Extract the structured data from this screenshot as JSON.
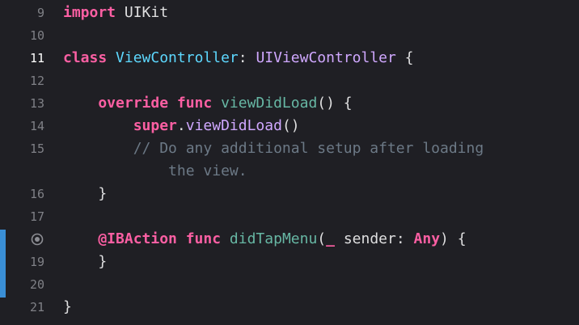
{
  "editor": {
    "lines": [
      {
        "number": "9",
        "tokens": [
          {
            "t": "import",
            "k": "kw"
          },
          {
            "t": " UIKit",
            "k": "plain"
          }
        ]
      },
      {
        "number": "10",
        "tokens": []
      },
      {
        "number": "11",
        "tokens": [
          {
            "t": "class",
            "k": "kw"
          },
          {
            "t": " ",
            "k": "plain"
          },
          {
            "t": "ViewController",
            "k": "type"
          },
          {
            "t": ": ",
            "k": "plain"
          },
          {
            "t": "UIViewController",
            "k": "sys"
          },
          {
            "t": " {",
            "k": "plain"
          }
        ]
      },
      {
        "number": "12",
        "tokens": []
      },
      {
        "number": "13",
        "tokens": [
          {
            "t": "    override func",
            "k": "kw"
          },
          {
            "t": " ",
            "k": "plain"
          },
          {
            "t": "viewDidLoad",
            "k": "fn"
          },
          {
            "t": "() {",
            "k": "plain"
          }
        ]
      },
      {
        "number": "14",
        "tokens": [
          {
            "t": "        super",
            "k": "kw"
          },
          {
            "t": ".",
            "k": "plain"
          },
          {
            "t": "viewDidLoad",
            "k": "sys"
          },
          {
            "t": "()",
            "k": "plain"
          }
        ]
      },
      {
        "number": "15",
        "tokens": [
          {
            "t": "        // Do any additional setup after loading",
            "k": "cm"
          }
        ]
      },
      {
        "number": "",
        "tokens": [
          {
            "t": "            the view.",
            "k": "cm"
          }
        ]
      },
      {
        "number": "16",
        "tokens": [
          {
            "t": "    }",
            "k": "plain"
          }
        ]
      },
      {
        "number": "17",
        "tokens": []
      },
      {
        "number": "",
        "marker": true,
        "tokens": [
          {
            "t": "    @IBAction func",
            "k": "kw"
          },
          {
            "t": " ",
            "k": "plain"
          },
          {
            "t": "didTapMenu",
            "k": "fn"
          },
          {
            "t": "(",
            "k": "plain"
          },
          {
            "t": "_",
            "k": "kw"
          },
          {
            "t": " sender: ",
            "k": "plain"
          },
          {
            "t": "Any",
            "k": "kw"
          },
          {
            "t": ") {",
            "k": "plain"
          }
        ]
      },
      {
        "number": "19",
        "tokens": [
          {
            "t": "    }",
            "k": "plain"
          }
        ]
      },
      {
        "number": "20",
        "tokens": []
      },
      {
        "number": "21",
        "tokens": [
          {
            "t": "}",
            "k": "plain"
          }
        ]
      }
    ],
    "current_line": "11",
    "colors": {
      "background": "#1f1f24",
      "keyword": "#fc5fa3",
      "type": "#5dd8ff",
      "system_type": "#d0a8ff",
      "function": "#67b7a4",
      "comment": "#6c7986",
      "change_bar": "#3a8fd6"
    },
    "icons": {
      "ibaction_marker": "ibaction-connection-icon"
    }
  }
}
